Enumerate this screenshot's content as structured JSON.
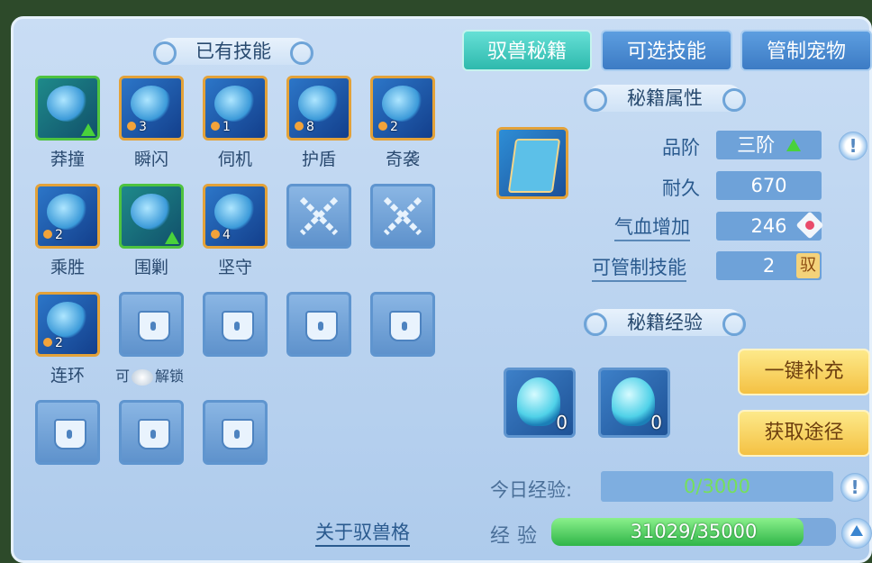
{
  "owned": {
    "title": "已有技能",
    "skills": [
      {
        "name": "莽撞",
        "count": "",
        "frame": "green",
        "upgrade": true
      },
      {
        "name": "瞬闪",
        "count": "3",
        "frame": "gold",
        "upgrade": false
      },
      {
        "name": "伺机",
        "count": "1",
        "frame": "gold",
        "upgrade": false
      },
      {
        "name": "护盾",
        "count": "8",
        "frame": "gold",
        "upgrade": false
      },
      {
        "name": "奇袭",
        "count": "2",
        "frame": "gold",
        "upgrade": false
      },
      {
        "name": "乘胜",
        "count": "2",
        "frame": "gold",
        "upgrade": false
      },
      {
        "name": "围剿",
        "count": "",
        "frame": "green",
        "upgrade": true
      },
      {
        "name": "坚守",
        "count": "4",
        "frame": "gold",
        "upgrade": false
      },
      {
        "name": "连环",
        "count": "2",
        "frame": "gold",
        "upgrade": false
      }
    ],
    "unlock_prefix": "可",
    "unlock_suffix": "解锁",
    "about_link": "关于驭兽格"
  },
  "tabs": [
    {
      "label": "驭兽秘籍",
      "active": true
    },
    {
      "label": "可选技能",
      "active": false
    },
    {
      "label": "管制宠物",
      "active": false
    }
  ],
  "book": {
    "attr_title": "秘籍属性",
    "attributes": {
      "rank": {
        "label": "品阶",
        "value": "三阶"
      },
      "durability": {
        "label": "耐久",
        "value": "670"
      },
      "hp_bonus": {
        "label": "气血增加",
        "value": "246"
      },
      "control": {
        "label": "可管制技能",
        "value": "2",
        "badge": "驭"
      }
    },
    "info_icon": "!"
  },
  "exp": {
    "title": "秘籍经验",
    "items": [
      {
        "count": "0"
      },
      {
        "count": "0"
      }
    ],
    "refill_button": "一键补充",
    "obtain_button": "获取途径",
    "today_label": "今日经验:",
    "today_value": "0/3000",
    "exp_label": "经验",
    "exp_value": "31029/35000",
    "exp_current": 31029,
    "exp_max": 35000
  },
  "colors": {
    "accent_teal": "#2eb9ad",
    "gold_frame": "#e3a239",
    "green_frame": "#4ec33f"
  }
}
